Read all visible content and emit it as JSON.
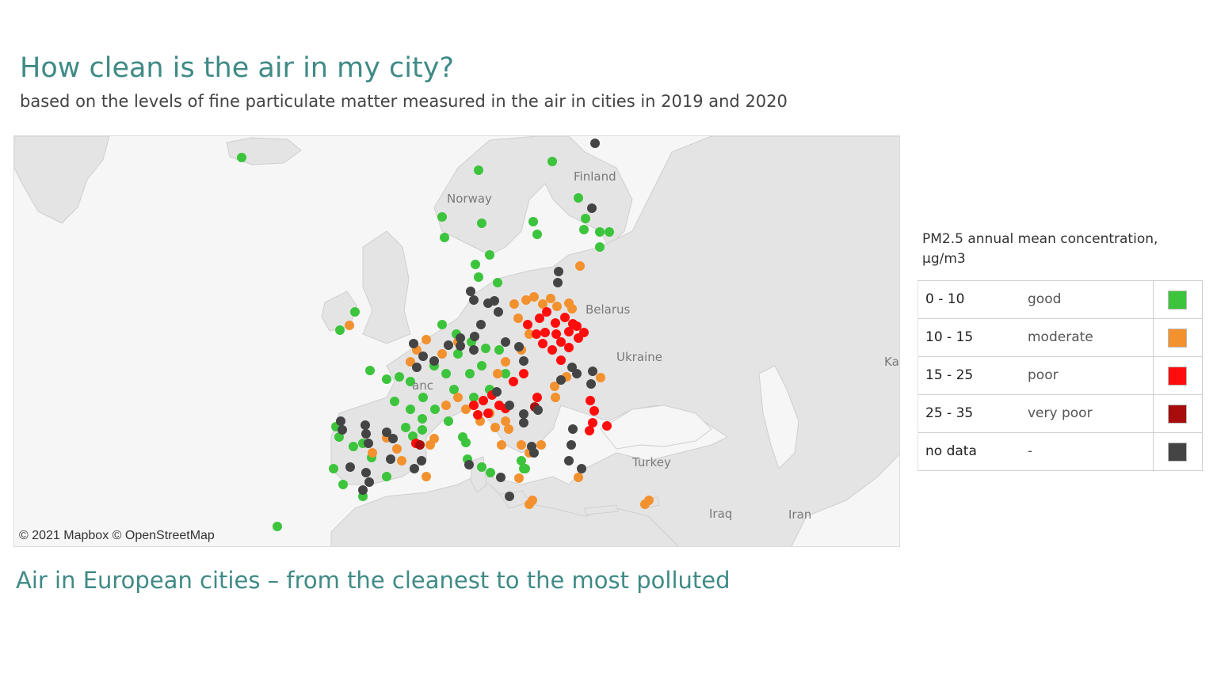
{
  "header": {
    "title": "How clean is the air in my city?",
    "subtitle": "based on the levels of fine particulate matter measured in the air in cities in 2019 and 2020"
  },
  "map": {
    "country_labels": {
      "finland": "Finland",
      "norway": "Norway",
      "belarus": "Belarus",
      "ukraine": "Ukraine",
      "kazakhstan_partial": "Ka",
      "france_partial": "anc",
      "turkey": "Turkey",
      "iraq": "Iraq",
      "iran": "Iran"
    },
    "attribution": "© 2021 Mapbox  © OpenStreetMap",
    "colors": {
      "good": "#3cc43c",
      "moderate": "#f2912e",
      "poor": "#ff0d0d",
      "very_poor": "#a80c0c",
      "no_data": "#444444",
      "land": "#e4e4e4",
      "sea": "#f6f6f6"
    }
  },
  "legend": {
    "title": "PM2.5 annual mean concentration, µg/m3",
    "items": [
      {
        "range": "0 - 10",
        "label": "good",
        "color": "#3cc43c"
      },
      {
        "range": "10 - 15",
        "label": "moderate",
        "color": "#f2912e"
      },
      {
        "range": "15 - 25",
        "label": "poor",
        "color": "#ff0d0d"
      },
      {
        "range": "25 - 35",
        "label": "very poor",
        "color": "#a80c0c"
      },
      {
        "range": "no data",
        "label": "-",
        "color": "#444444"
      }
    ]
  },
  "section": {
    "title": "Air in European cities – from the cleanest to the most polluted"
  }
}
